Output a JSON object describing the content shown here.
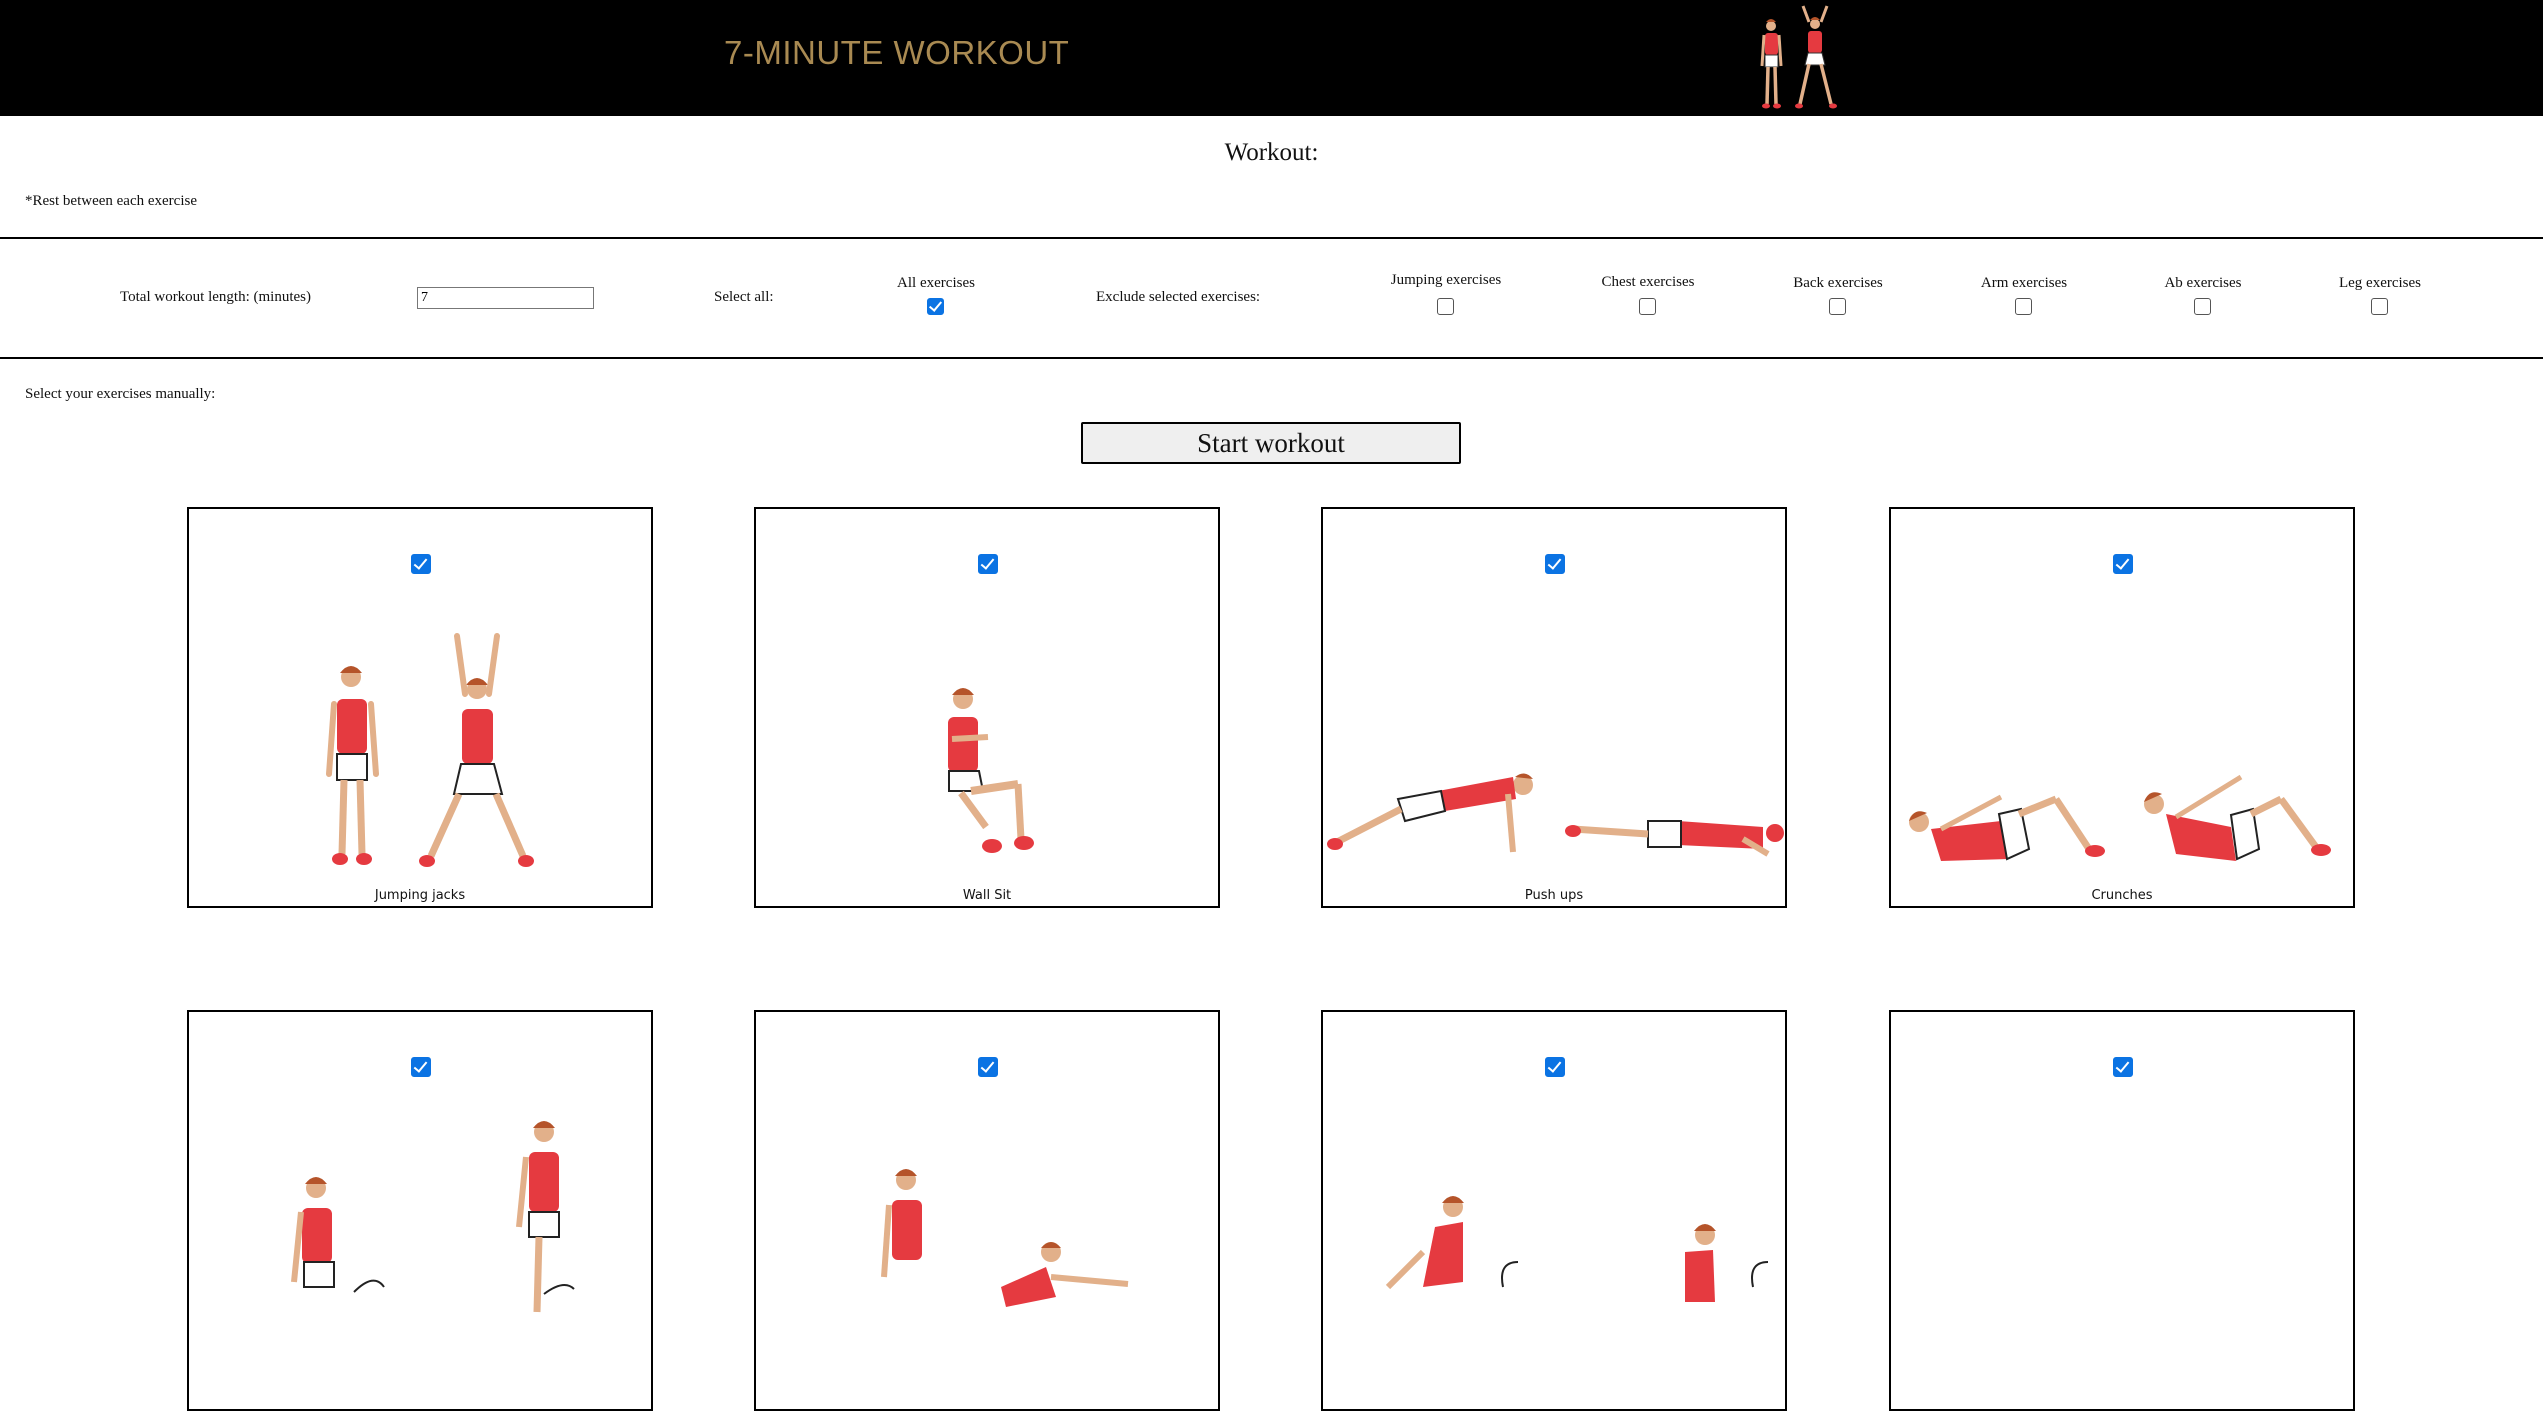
{
  "header": {
    "title": "7-MINUTE WORKOUT"
  },
  "page": {
    "heading": "Workout:",
    "rest_note": "*Rest between each exercise",
    "manual_label": "Select your exercises manually:",
    "start_button": "Start workout"
  },
  "options": {
    "length_label": "Total workout length: (minutes)",
    "length_value": "7",
    "select_all_label": "Select all:",
    "all_exercises_label": "All exercises",
    "all_exercises_checked": true,
    "exclude_label": "Exclude selected exercises:",
    "exclude": [
      {
        "label": "Jumping exercises",
        "checked": false
      },
      {
        "label": "Chest exercises",
        "checked": false
      },
      {
        "label": "Back exercises",
        "checked": false
      },
      {
        "label": "Arm exercises",
        "checked": false
      },
      {
        "label": "Ab exercises",
        "checked": false
      },
      {
        "label": "Leg exercises",
        "checked": false
      }
    ]
  },
  "exercises": [
    {
      "label": "Jumping jacks",
      "checked": true
    },
    {
      "label": "Wall Sit",
      "checked": true
    },
    {
      "label": "Push ups",
      "checked": true
    },
    {
      "label": "Crunches",
      "checked": true
    },
    {
      "label": "",
      "checked": true
    },
    {
      "label": "",
      "checked": true
    },
    {
      "label": "",
      "checked": true
    },
    {
      "label": "",
      "checked": true
    }
  ],
  "colors": {
    "header_bg": "#000000",
    "title_gold": "#a98a52",
    "shirt_red": "#e53a40",
    "skin": "#e2b08a",
    "checkbox_blue": "#0b73e3"
  }
}
